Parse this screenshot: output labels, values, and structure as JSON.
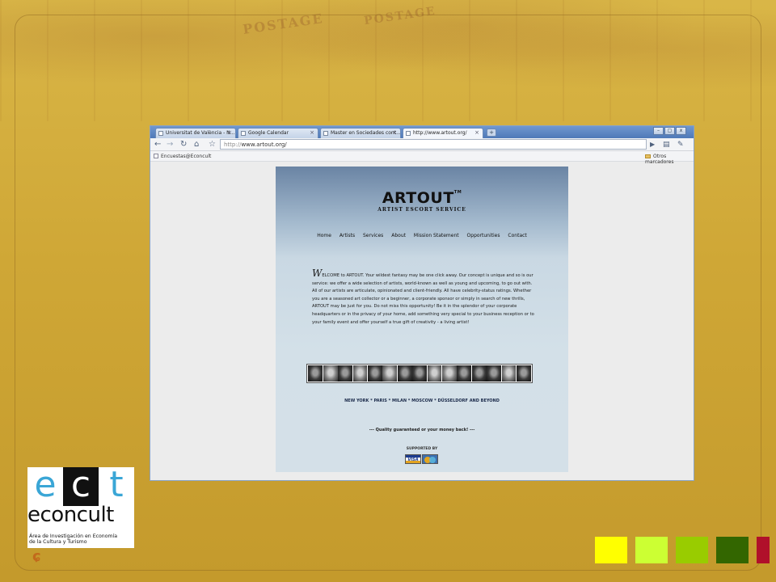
{
  "slide": {
    "background_stamps": [
      "POSTAGE",
      "POSTAGE"
    ],
    "square_colors": [
      "#ffff00",
      "#ccff33",
      "#99cc00",
      "#336600",
      "#b0102a"
    ]
  },
  "browser": {
    "tabs": [
      {
        "label": "Universitat de València - N...",
        "active": false
      },
      {
        "label": "Google Calendar",
        "active": false
      },
      {
        "label": "Master en Sociedades cont...",
        "active": false
      },
      {
        "label": "http://www.artout.org/",
        "active": true
      }
    ],
    "new_tab_label": "+",
    "window_controls": {
      "minimize": "–",
      "maximize": "▢",
      "close": "x"
    },
    "address": {
      "protocol": "http://",
      "host": "www.artout.org/"
    },
    "bookmarks": {
      "left": "Encuestas@Econcult",
      "right": "Otros marcadores"
    }
  },
  "site": {
    "logo": "ARTOUT",
    "logo_mark": "TM",
    "tagline": "ARTIST ESCORT SERVICE",
    "nav": [
      "Home",
      "Artists",
      "Services",
      "About",
      "Mission Statement",
      "Opportunities",
      "Contact"
    ],
    "welcome_initial": "W",
    "welcome_text": "ELCOME to ARTOUT. Your wildest fantasy may be one click away. Our concept is unique and so is our service: we offer a wide selection of artists, world-known as well as young and upcoming, to go out with. All of our artists are articulate, opinionated and client-friendly. All have celebrity-status ratings. Whether you are a seasoned art collector or a beginner, a corporate sponsor or simply in search of new thrills, ARTOUT may be just for you.  Do not miss this opportunity! Be it in the splendor of your corporate headquarters or in the privacy of your home, add something very special to your business reception or to your family event and offer yourself a true gift of creativity - a living artist!",
    "cities": "NEW YORK * PARIS * MILAN * MOSCOW * DÜSSELDORF AND BEYOND",
    "quality": "--- Quality guaranteed or your money back! ---",
    "supported_by": "SUPPORTED BY",
    "card_visa": "VISA"
  },
  "econcult": {
    "letters": [
      "e",
      "c",
      "t"
    ],
    "word": "econcult",
    "subtitle_line1": "Área de Investigación en Economía",
    "subtitle_line2": "de la Cultura y Turismo"
  }
}
